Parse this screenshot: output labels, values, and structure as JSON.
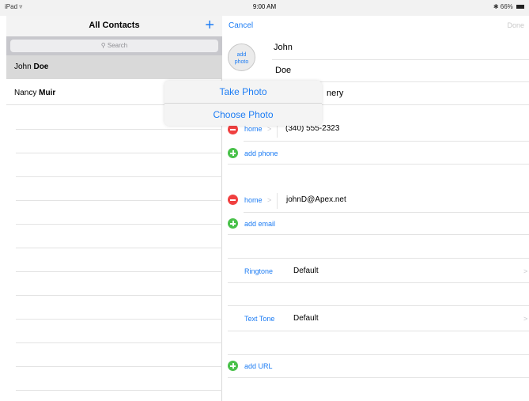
{
  "status_bar": {
    "device": "iPad",
    "wifi": "▿",
    "time": "9:00 AM",
    "battery": "66%",
    "bluetooth": "✱"
  },
  "left": {
    "title": "All Contacts",
    "add_icon": "+",
    "search_placeholder": "Search",
    "contacts": [
      {
        "first": "John",
        "last": "Doe",
        "selected": true
      },
      {
        "first": "Nancy",
        "last": "Muir",
        "selected": false
      }
    ]
  },
  "right": {
    "cancel": "Cancel",
    "done": "Done",
    "add_photo_line1": "add",
    "add_photo_line2": "photo",
    "first_name": "John",
    "last_name": "Doe",
    "company_partial": "nery",
    "phone_label": "home",
    "phone_value": "(340) 555-2323",
    "add_phone": "add phone",
    "email_label": "home",
    "email_value": "johnD@Apex.net",
    "add_email": "add email",
    "ringtone_label": "Ringtone",
    "ringtone_value": "Default",
    "text_tone_label": "Text Tone",
    "text_tone_value": "Default",
    "add_url": "add URL",
    "chevron": ">"
  },
  "popover": {
    "take_photo": "Take Photo",
    "choose_photo": "Choose Photo"
  },
  "colors": {
    "accent": "#1c7cf4",
    "delete": "#f04040",
    "add": "#49c14a"
  }
}
